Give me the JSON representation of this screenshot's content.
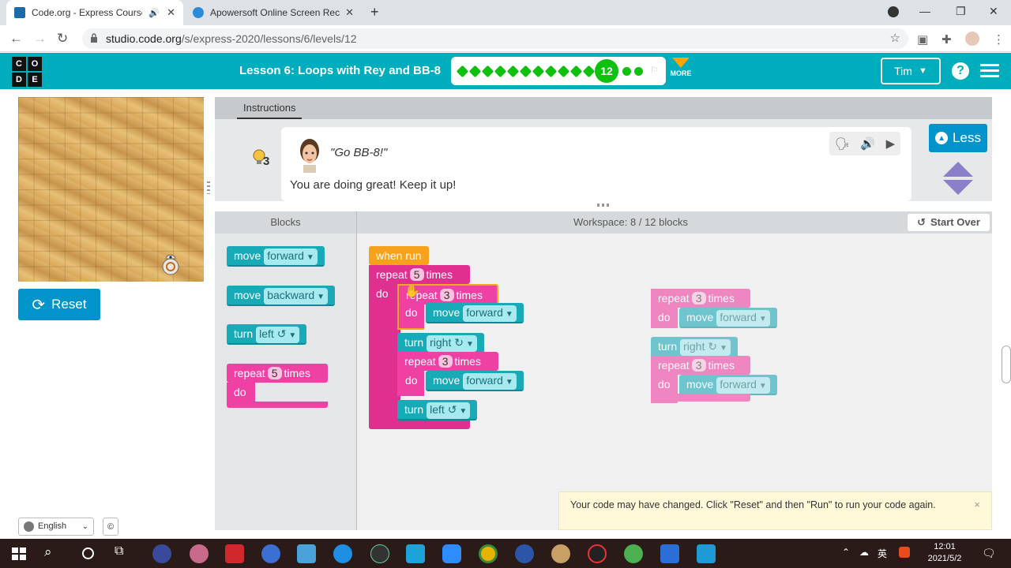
{
  "browser": {
    "tabs": [
      {
        "title": "Code.org - Express Course",
        "active": true
      },
      {
        "title": "Apowersoft Online Screen Rec",
        "active": false
      }
    ],
    "new_tab": "+",
    "url_host": "studio.code.org",
    "url_path": "/s/express-2020/lessons/6/levels/12"
  },
  "header": {
    "logo_letters": [
      "C",
      "O",
      "D",
      "E"
    ],
    "lesson_title": "Lesson 6: Loops with Rey and BB-8",
    "current_level": "12",
    "completed_levels": 11,
    "upcoming_levels": 2,
    "more_label": "MORE",
    "user_name": "Tim",
    "help": "?"
  },
  "left_pane": {
    "reset_label": "Reset",
    "language": "English",
    "copyright": "©"
  },
  "instructions": {
    "tab_label": "Instructions",
    "hint_count": "3",
    "quote": "\"Go BB-8!\"",
    "text": "You are doing great! Keep it up!",
    "less_label": "Less"
  },
  "blocks": {
    "toolbox_title": "Blocks",
    "workspace_title": "Workspace: 8 / 12 blocks",
    "start_over": "Start Over",
    "toolbox": [
      {
        "verb": "move",
        "arg": "forward"
      },
      {
        "verb": "move",
        "arg": "backward"
      },
      {
        "verb": "turn",
        "arg": "left ↺"
      },
      {
        "verb": "repeat",
        "count": "5",
        "suffix": "times",
        "do": "do"
      }
    ],
    "program": {
      "when_run": "when run",
      "outer_repeat": {
        "label": "repeat",
        "count": "5",
        "suffix": "times",
        "do": "do"
      },
      "inner_repeat_1": {
        "label": "repeat",
        "count": "3",
        "suffix": "times",
        "do": "do"
      },
      "move_1": {
        "verb": "move",
        "arg": "forward"
      },
      "turn_1": {
        "verb": "turn",
        "arg": "right ↻"
      },
      "inner_repeat_2": {
        "label": "repeat",
        "count": "3",
        "suffix": "times",
        "do": "do"
      },
      "move_2": {
        "verb": "move",
        "arg": "forward"
      },
      "turn_2": {
        "verb": "turn",
        "arg": "left ↺"
      }
    },
    "detached": {
      "repeat_a": {
        "label": "repeat",
        "count": "3",
        "suffix": "times",
        "do": "do"
      },
      "move_a": {
        "verb": "move",
        "arg": "forward"
      },
      "turn_a": {
        "verb": "turn",
        "arg": "right ↻"
      },
      "repeat_b": {
        "label": "repeat",
        "count": "3",
        "suffix": "times",
        "do": "do"
      },
      "move_b": {
        "verb": "move",
        "arg": "forward"
      }
    }
  },
  "toast": {
    "message": "Your code may have changed. Click \"Reset\" and then \"Run\" to run your code again.",
    "close": "×"
  },
  "taskbar": {
    "ime": "英",
    "time": "12:01",
    "date": "2021/5/2"
  },
  "colors": {
    "header": "#00adbc",
    "progress_green": "#0ec10e",
    "button_blue": "#0094ca",
    "block_teal": "#19aab8",
    "block_pink": "#ef41a4",
    "block_orange": "#f7a21a"
  }
}
